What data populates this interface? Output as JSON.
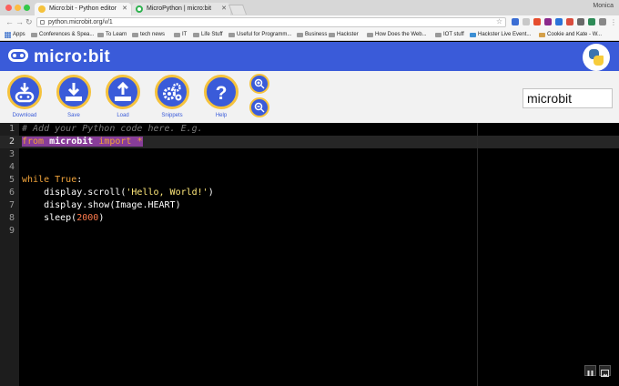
{
  "browser": {
    "tabs": [
      {
        "title": "Micro:bit - Python editor",
        "active": true
      },
      {
        "title": "MicroPython | micro:bit",
        "active": false
      }
    ],
    "profile": "Monica",
    "url": "python.microbit.org/v/1",
    "bookmarks": [
      "Apps",
      "Conferences & Spea...",
      "To Learn",
      "tech news",
      "IT",
      "Life Stuff",
      "Useful for Programm...",
      "Business",
      "Hackster",
      "How Does the Web...",
      "IOT stuff",
      "Hackster Live Event...",
      "Cookie and Kate - W..."
    ]
  },
  "header": {
    "brand": "micro:bit"
  },
  "toolbar": {
    "download": "Download",
    "save": "Save",
    "load": "Load",
    "snippets": "Snippets",
    "help": "Help"
  },
  "project": {
    "name": "microbit"
  },
  "editor": {
    "line_numbers": [
      "1",
      "2",
      "3",
      "4",
      "5",
      "6",
      "7",
      "8",
      "9"
    ],
    "lines": {
      "l1": "# Add your Python code here. E.g.",
      "l2_from": "from",
      "l2_mod": "microbit",
      "l2_import": "import",
      "l2_star": "*",
      "l5_kw": "while",
      "l5_true": "True",
      "l5_colon": ":",
      "l6_call": "    display.scroll(",
      "l6_str": "'Hello, World!'",
      "l6_end": ")",
      "l7": "    display.show(Image.HEART)",
      "l8_call": "    sleep(",
      "l8_num": "2000",
      "l8_end": ")"
    }
  },
  "colors": {
    "brand_blue": "#3a5bd9",
    "accent_yellow": "#f5c23c",
    "keyword": "#f0a33a",
    "string": "#ffe87a",
    "number": "#ff7b4d",
    "selection": "#883d99"
  }
}
